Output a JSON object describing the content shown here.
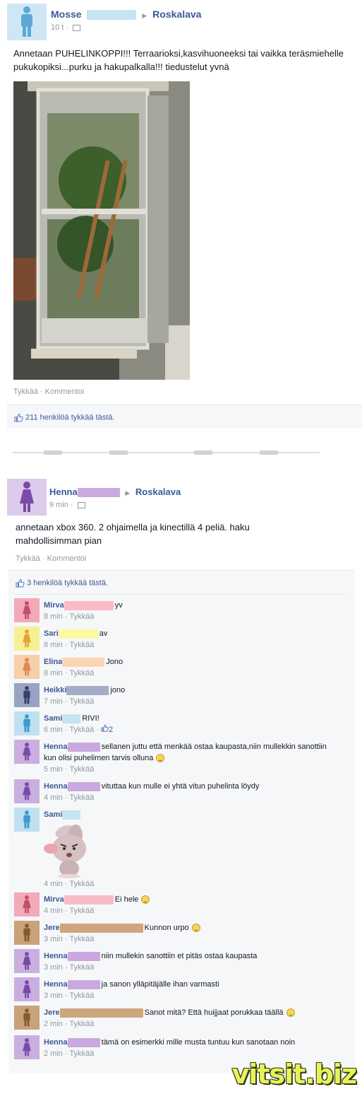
{
  "post1": {
    "author": "Mosse",
    "group": "Roskalava",
    "time": "10 t ·",
    "text": "Annetaan PUHELINKOPPI!!! Terraarioksi,kasvihuoneeksi tai vaikka teräsmiehelle pukukopiksi...purku ja hakupalkalla!!! tiedustelut yvnä",
    "actions": {
      "like": "Tykkää",
      "sep": " · ",
      "comment": "Kommentoi"
    },
    "likes": "211 henkilöä tykkää tästä.",
    "avatar_color": "#5da9d6"
  },
  "post2": {
    "author": "Henna",
    "group": "Roskalava",
    "time": "9 min ·",
    "text": "annetaan xbox 360. 2 ohjaimella ja kinectillä 4 peliä. haku mahdollisimman pian",
    "actions": {
      "like": "Tykkää",
      "sep": " · ",
      "comment": "Kommentoi"
    },
    "likes": "3 henkilöä tykkää tästä.",
    "avatar_color": "#9b6fc0"
  },
  "comments": [
    {
      "name": "Mirva",
      "text": "yv",
      "meta": "8 min · Tykkää",
      "color": "#f2a9b8",
      "fig": "#c0506a",
      "redact": "#f7bcc8",
      "rw": 70,
      "gender": "f"
    },
    {
      "name": "Sari",
      "text": "av",
      "meta": "8 min · Tykkää",
      "color": "#f7ef93",
      "fig": "#e0a43a",
      "redact": "#fafaa0",
      "rw": 56,
      "gender": "f"
    },
    {
      "name": "Elina",
      "text": "Jono",
      "meta": "8 min · Tykkää",
      "color": "#f7cfa8",
      "fig": "#e08a55",
      "redact": "#fbd6b2",
      "rw": 60,
      "gender": "f"
    },
    {
      "name": "Heikki",
      "text": "jono",
      "meta": "7 min · Tykkää",
      "color": "#9aa3c4",
      "fig": "#34406e",
      "redact": "#a4adc8",
      "rw": 60,
      "gender": "m"
    },
    {
      "name": "Sami",
      "text": "RIVI!",
      "meta": "6 min · Tykkää ·",
      "extra": "2",
      "color": "#bfe0f0",
      "fig": "#3b9ad0",
      "redact": "#c6e4f2",
      "rw": 26,
      "gender": "m"
    },
    {
      "name": "Henna",
      "text": "sellanen juttu että menkää ostaa kaupasta,niin mullekkin sanottiin kun olisi  puhelimen tarvis olluna",
      "meta": "5 min · Tykkää",
      "color": "#c9aee0",
      "fig": "#7a4aa6",
      "redact": "#c9a9e0",
      "rw": 46,
      "gender": "f",
      "smiley": true
    },
    {
      "name": "Henna",
      "text": "vituttaa kun mulle ei yhtä vitun puhelinta löydy",
      "meta": "4 min · Tykkää",
      "color": "#c9aee0",
      "fig": "#7a4aa6",
      "redact": "#c9a9e0",
      "rw": 46,
      "gender": "f"
    },
    {
      "name": "Sami",
      "text": "",
      "meta": "4 min · Tykkää",
      "color": "#bfe0f0",
      "fig": "#3b9ad0",
      "redact": "#c6e4f2",
      "rw": 26,
      "gender": "m",
      "sticker": true
    },
    {
      "name": "Mirva",
      "text": "Ei hele",
      "meta": "4 min · Tykkää",
      "color": "#f2a9b8",
      "fig": "#c0506a",
      "redact": "#f7bcc8",
      "rw": 70,
      "gender": "f",
      "smiley": true
    },
    {
      "name": "Jere",
      "text": "Kunnon urpo",
      "meta": "3 min · Tykkää",
      "color": "#c9a27a",
      "fig": "#8a5a2e",
      "redact": "#cfa57e",
      "rw": 118,
      "gender": "m",
      "smiley": true
    },
    {
      "name": "Henna",
      "text": "niin mullekin sanottiin et pitäs ostaa kaupasta",
      "meta": "3 min · Tykkää",
      "color": "#c9aee0",
      "fig": "#7a4aa6",
      "redact": "#c9a9e0",
      "rw": 46,
      "gender": "f"
    },
    {
      "name": "Henna",
      "text": "ja sanon ylläpitäjälle ihan varmasti",
      "meta": "3 min · Tykkää",
      "color": "#c9aee0",
      "fig": "#7a4aa6",
      "redact": "#c9a9e0",
      "rw": 46,
      "gender": "f"
    },
    {
      "name": "Jere",
      "text": "Sanot mitä? Että huijjaat porukkaa täällä",
      "meta": "2 min · Tykkää",
      "color": "#c9a27a",
      "fig": "#8a5a2e",
      "redact": "#cfa57e",
      "rw": 118,
      "gender": "m",
      "smiley": true
    },
    {
      "name": "Henna",
      "text": "tämä on esimerkki mille musta tuntuu kun sanotaan noin",
      "meta": "2 min · Tykkää",
      "color": "#c9aee0",
      "fig": "#7a4aa6",
      "redact": "#c9a9e0",
      "rw": 46,
      "gender": "f"
    }
  ],
  "watermark": "vitsit.biz"
}
